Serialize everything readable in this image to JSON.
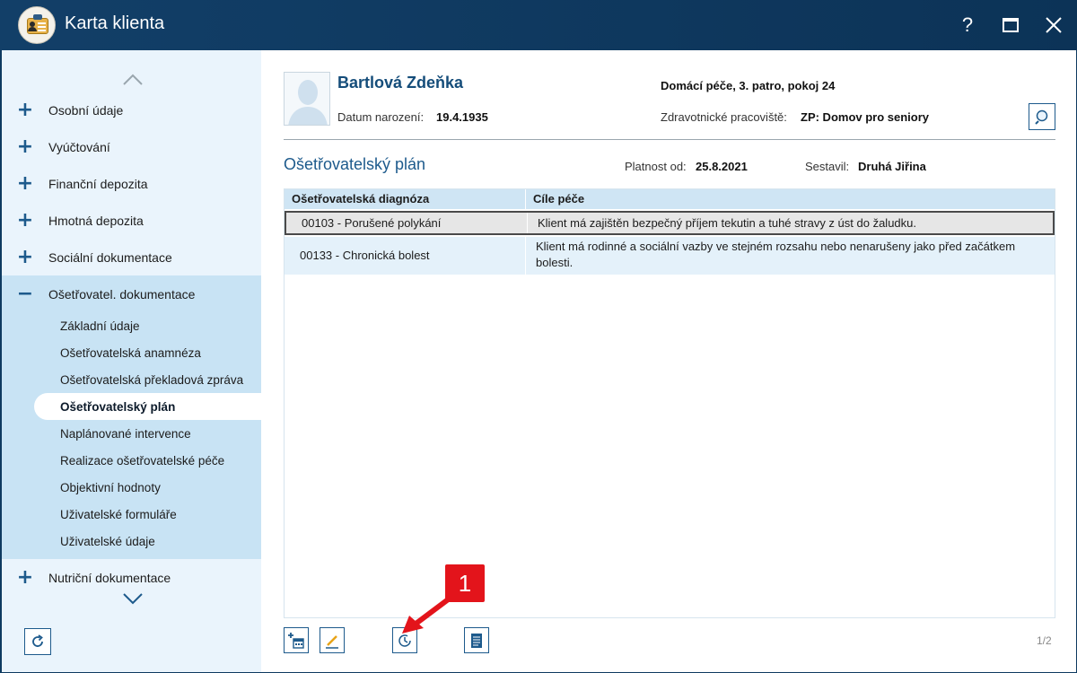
{
  "window": {
    "title": "Karta klienta",
    "help_label": "?",
    "close_label": "✕"
  },
  "sidebar": {
    "items_top": [
      {
        "sign": "+",
        "label": "Osobní údaje"
      },
      {
        "sign": "+",
        "label": "Vyúčtování"
      },
      {
        "sign": "+",
        "label": "Finanční depozita"
      },
      {
        "sign": "+",
        "label": "Hmotná depozita"
      },
      {
        "sign": "+",
        "label": "Sociální dokumentace"
      }
    ],
    "group": {
      "sign": "−",
      "label": "Ošetřovatel. dokumentace",
      "children": [
        "Základní údaje",
        "Ošetřovatelská anamnéza",
        "Ošetřovatelská překladová zpráva",
        "Ošetřovatelský plán",
        "Naplánované intervence",
        "Realizace ošetřovatelské péče",
        "Objektivní hodnoty",
        "Uživatelské formuláře",
        "Uživatelské údaje"
      ],
      "active_index": 3
    },
    "items_bottom": [
      {
        "sign": "+",
        "label": "Nutriční dokumentace"
      }
    ]
  },
  "client": {
    "name": "Bartlová Zdeňka",
    "dob_label": "Datum narození:",
    "dob": "19.4.1935",
    "location": "Domácí péče, 3. patro, pokoj 24",
    "facility_label": "Zdravotnické pracoviště:",
    "facility": "ZP: Domov pro seniory"
  },
  "plan": {
    "title": "Ošetřovatelský plán",
    "valid_label": "Platnost od:",
    "valid_from": "25.8.2021",
    "author_label": "Sestavil:",
    "author": "Druhá Jiřina"
  },
  "table": {
    "columns": [
      "Ošetřovatelská diagnóza",
      "Cíle péče"
    ],
    "rows": [
      {
        "diagnosis": "00103 - Porušené polykání",
        "goal": "Klient má zajištěn bezpečný příjem tekutin a tuhé stravy z úst do žaludku."
      },
      {
        "diagnosis": "00133 - Chronická bolest",
        "goal": "Klient má rodinné a sociální vazby ve stejném rozsahu nebo nenarušeny jako před začátkem bolesti."
      }
    ]
  },
  "footer": {
    "page": "1/2"
  },
  "callout": {
    "number": "1",
    "color": "#e3141b"
  },
  "colors": {
    "titlebar": "#0e3a60",
    "accent": "#1d5a8c",
    "sidebar_bg": "#eaf4fc",
    "group_bg": "#c8e3f4",
    "header_bg": "#cfe5f4"
  }
}
